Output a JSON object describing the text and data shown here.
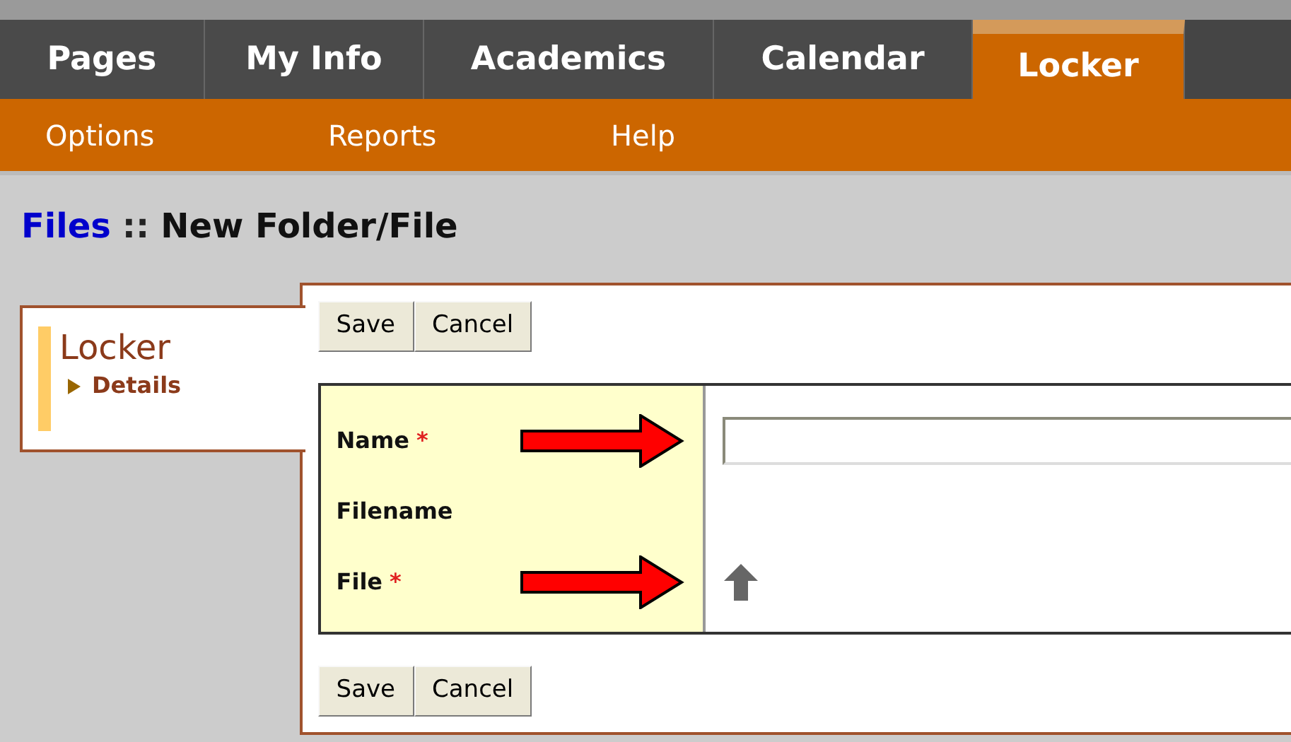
{
  "tabs": [
    {
      "label": "Pages",
      "selected": false
    },
    {
      "label": "My Info",
      "selected": false
    },
    {
      "label": "Academics",
      "selected": false
    },
    {
      "label": "Calendar",
      "selected": false
    },
    {
      "label": "Locker",
      "selected": true
    }
  ],
  "subnav": [
    "Options",
    "Reports",
    "Help"
  ],
  "breadcrumb": {
    "link": "Files",
    "separator": "::",
    "title": "New Folder/File"
  },
  "sidebar": {
    "title": "Locker",
    "items": [
      "Details"
    ]
  },
  "buttons_top": [
    "Save",
    "Cancel"
  ],
  "fields": [
    {
      "label": "Name",
      "required_mark": "*",
      "kind": "text"
    },
    {
      "label": "Filename",
      "kind": "none"
    },
    {
      "label": "File",
      "required_mark": "*",
      "kind": "file"
    }
  ],
  "buttons_bottom": [
    "Save",
    "Cancel"
  ]
}
